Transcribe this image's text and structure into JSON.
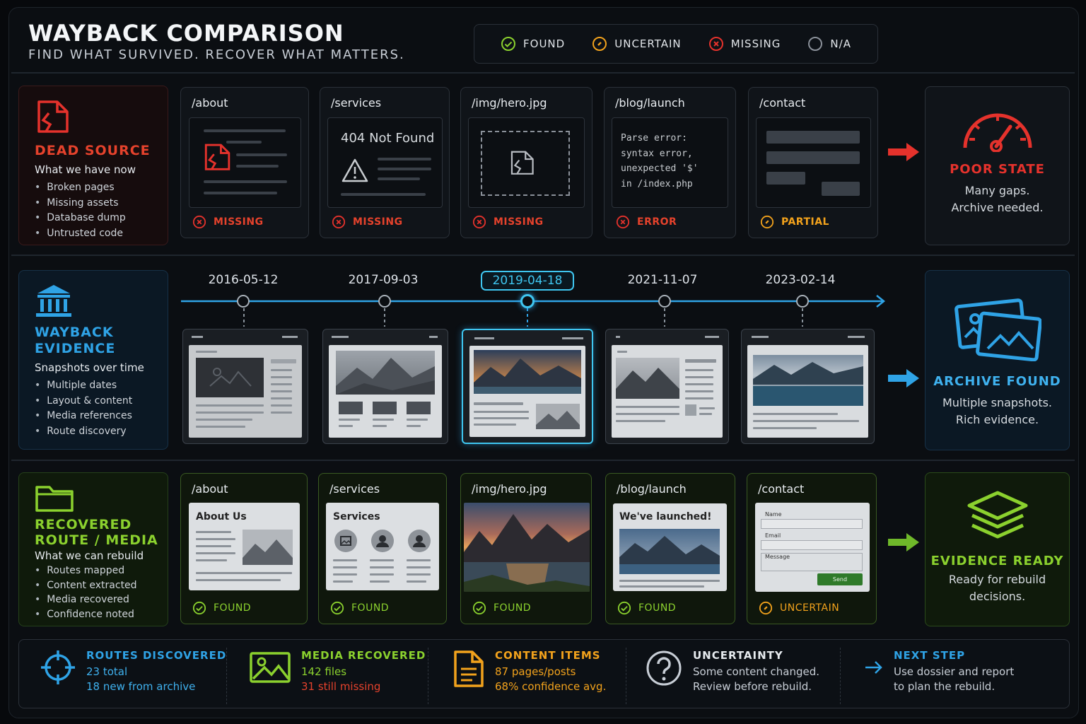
{
  "header": {
    "title": "WAYBACK COMPARISON",
    "subtitle": "FIND WHAT SURVIVED. RECOVER WHAT MATTERS."
  },
  "legend": [
    {
      "label": "FOUND",
      "color": "#8bd12e",
      "icon": "check-circle-icon"
    },
    {
      "label": "UNCERTAIN",
      "color": "#f2a21c",
      "icon": "dot-circle-icon"
    },
    {
      "label": "MISSING",
      "color": "#e5322c",
      "icon": "x-circle-icon"
    },
    {
      "label": "N/A",
      "color": "#8a9099",
      "icon": "empty-circle-icon"
    }
  ],
  "dead": {
    "title": "DEAD SOURCE",
    "subtitle": "What we have now",
    "bullets": [
      "Broken pages",
      "Missing assets",
      "Database dump",
      "Untrusted code"
    ],
    "color": "#e5322c"
  },
  "dead_cards": [
    {
      "path": "/about",
      "status": "MISSING"
    },
    {
      "path": "/services",
      "status": "MISSING",
      "notfound": "404 Not Found"
    },
    {
      "path": "/img/hero.jpg",
      "status": "MISSING"
    },
    {
      "path": "/blog/launch",
      "status": "ERROR",
      "code": [
        "Parse error:",
        "syntax error,",
        "unexpected '$'",
        "in /index.php"
      ]
    },
    {
      "path": "/contact",
      "status": "PARTIAL"
    }
  ],
  "poor": {
    "title": "POOR STATE",
    "text": [
      "Many gaps.",
      "Archive needed."
    ]
  },
  "wayback": {
    "title": [
      "WAYBACK",
      "EVIDENCE"
    ],
    "subtitle": "Snapshots over time",
    "bullets": [
      "Multiple dates",
      "Layout & content",
      "Media references",
      "Route discovery"
    ],
    "color": "#2fa3e6"
  },
  "timeline": {
    "dates": [
      "2016-05-12",
      "2017-09-03",
      "2019-04-18",
      "2021-11-07",
      "2023-02-14"
    ],
    "selected": "2019-04-18"
  },
  "archive": {
    "title": "ARCHIVE FOUND",
    "text": [
      "Multiple snapshots.",
      "Rich evidence."
    ]
  },
  "recovered": {
    "title": [
      "RECOVERED",
      "ROUTE / MEDIA"
    ],
    "subtitle": "What we can rebuild",
    "bullets": [
      "Routes mapped",
      "Content extracted",
      "Media recovered",
      "Confidence noted"
    ],
    "color": "#8bd12e"
  },
  "rec_cards": [
    {
      "path": "/about",
      "status": "FOUND",
      "heading": "About Us"
    },
    {
      "path": "/services",
      "status": "FOUND",
      "heading": "Services"
    },
    {
      "path": "/img/hero.jpg",
      "status": "FOUND"
    },
    {
      "path": "/blog/launch",
      "status": "FOUND",
      "heading": "We've launched!"
    },
    {
      "path": "/contact",
      "status": "UNCERTAIN",
      "form": {
        "name": "Name",
        "email": "Email",
        "message": "Message",
        "send": "Send"
      }
    }
  ],
  "ready": {
    "title": "EVIDENCE READY",
    "text": [
      "Ready for rebuild",
      "decisions."
    ]
  },
  "stats": [
    {
      "title": "ROUTES DISCOVERED",
      "line1": "23 total",
      "line2": "18 new from archive",
      "color": "#2fa3e6",
      "c2": "#2fa3e6"
    },
    {
      "title": "MEDIA RECOVERED",
      "line1": "142 files",
      "line2": "31 still missing",
      "color": "#8bd12e",
      "c2": "#e5422c"
    },
    {
      "title": "CONTENT ITEMS",
      "line1": "87 pages/posts",
      "line2": "68% confidence avg.",
      "color": "#f2a21c",
      "c2": "#f2a21c"
    },
    {
      "title": "UNCERTAINTY",
      "line1": "Some content changed.",
      "line2": "Review before rebuild.",
      "color": "#e6eaee",
      "c2": "#c8ced6"
    },
    {
      "title": "NEXT STEP",
      "line1": "Use dossier and report",
      "line2": "to plan the rebuild.",
      "color": "#2fa3e6",
      "c2": "#c8ced6"
    }
  ]
}
